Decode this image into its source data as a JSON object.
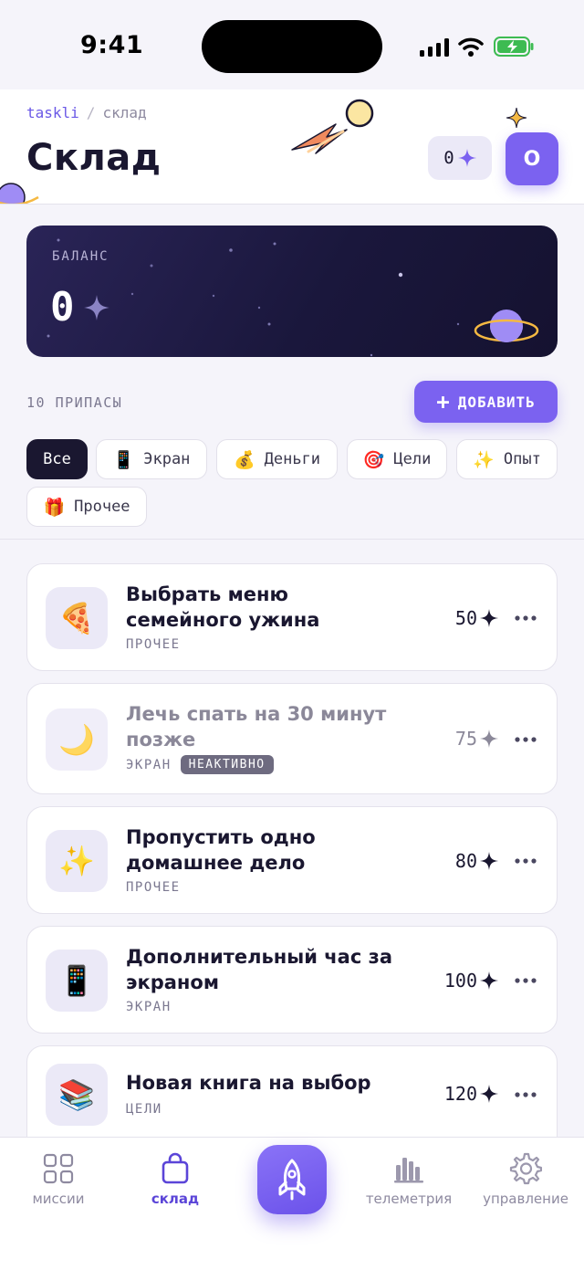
{
  "status_bar": {
    "time": "9:41"
  },
  "header": {
    "breadcrumb": {
      "root": "taskli",
      "separator": "/",
      "current": "склад"
    },
    "title": "Склад",
    "balance_chip": "0",
    "avatar_initial": "O"
  },
  "balance": {
    "label": "БАЛАНС",
    "value": "0"
  },
  "supplies": {
    "count_label": "10 ПРИПАСЫ",
    "add_label": "ДОБАВИТЬ"
  },
  "filters": [
    {
      "label": "Все",
      "icon": "",
      "active": true
    },
    {
      "label": "Экран",
      "icon": "📱"
    },
    {
      "label": "Деньги",
      "icon": "💰"
    },
    {
      "label": "Цели",
      "icon": "🎯"
    },
    {
      "label": "Опыт",
      "icon": "✨"
    },
    {
      "label": "Прочее",
      "icon": "🎁"
    }
  ],
  "items": [
    {
      "title": "Выбрать меню семейного ужина",
      "category": "ПРОЧЕЕ",
      "price": "50",
      "icon": "🍕",
      "inactive": false
    },
    {
      "title": "Лечь спать на 30 минут позже",
      "category": "ЭКРАН",
      "badge": "НЕАКТИВНО",
      "price": "75",
      "icon": "🌙",
      "inactive": true
    },
    {
      "title": "Пропустить одно домашнее дело",
      "category": "ПРОЧЕЕ",
      "price": "80",
      "icon": "✨",
      "inactive": false
    },
    {
      "title": "Дополнительный час за экраном",
      "category": "ЭКРАН",
      "price": "100",
      "icon": "📱",
      "inactive": false
    },
    {
      "title": "Новая книга на выбор",
      "category": "ЦЕЛИ",
      "price": "120",
      "icon": "📚",
      "inactive": false
    }
  ],
  "nav": {
    "missions": "миссии",
    "warehouse": "склад",
    "telemetry": "телеметрия",
    "management": "управление"
  },
  "colors": {
    "accent": "#7b62f0",
    "dark": "#1a1730",
    "background": "#f5f4fa"
  }
}
